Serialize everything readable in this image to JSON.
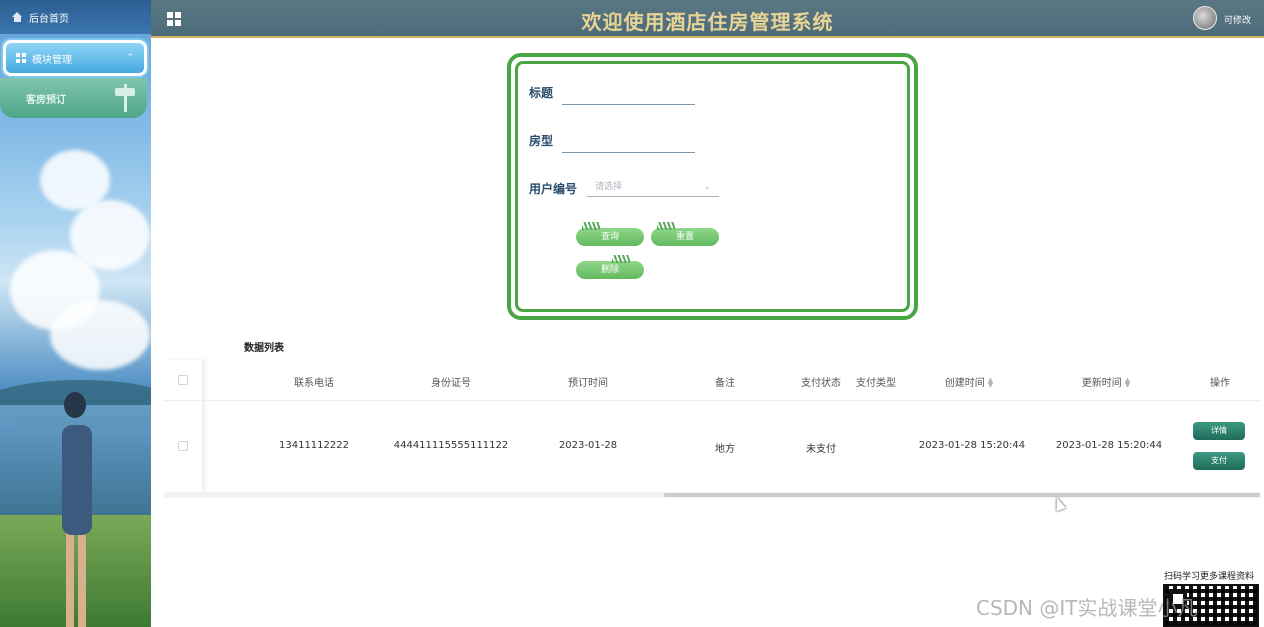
{
  "sidebar": {
    "home_label": "后台首页",
    "menu_label": "模块管理",
    "sub_item_label": "客房预订"
  },
  "header": {
    "title": "欢迎使用酒店住房管理系统",
    "user_name": "可修改"
  },
  "search": {
    "title_label": "标题",
    "title_value": "",
    "room_type_label": "房型",
    "room_type_value": "",
    "user_id_label": "用户编号",
    "user_id_placeholder": "请选择",
    "query_button": "查询",
    "reset_button": "重置",
    "delete_button": "删除"
  },
  "list": {
    "title": "数据列表",
    "columns": [
      "联系电话",
      "身份证号",
      "预订时间",
      "备注",
      "支付状态",
      "支付类型",
      "创建时间",
      "更新时间",
      "操作"
    ],
    "rows": [
      {
        "phone": "13411112222",
        "id_card": "444411115555111122",
        "booking_time": "2023-01-28",
        "remark": "地方",
        "pay_status": "未支付",
        "pay_type": "",
        "created": "2023-01-28 15:20:44",
        "updated": "2023-01-28 15:20:44",
        "detail_button": "详情",
        "pay_button": "支付"
      }
    ]
  },
  "promo": {
    "qr_caption": "扫码学习更多课程资料",
    "watermark": "CSDN @IT实战课堂小凡"
  },
  "colors": {
    "header_bg": "#4f6e7c",
    "title_gold": "#e8d494",
    "form_border": "#4aa645",
    "button_green": "#7cc878",
    "action_teal": "#2d806d"
  }
}
